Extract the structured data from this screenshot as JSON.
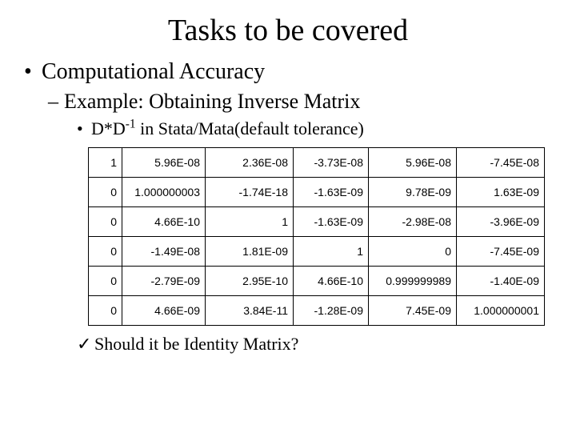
{
  "title": "Tasks to be covered",
  "bullet1": "Computational Accuracy",
  "bullet2": "Example: Obtaining Inverse Matrix",
  "bullet3_pre": "D*D",
  "bullet3_sup": "-1",
  "bullet3_post": " in Stata/Mata(default tolerance)",
  "checkline": "Should it be Identity Matrix?",
  "chart_data": {
    "type": "table",
    "title": "D*D^-1 in Stata/Mata (default tolerance)",
    "rows": [
      [
        "1",
        "5.96E-08",
        "2.36E-08",
        "-3.73E-08",
        "5.96E-08",
        "-7.45E-08"
      ],
      [
        "0",
        "1.000000003",
        "-1.74E-18",
        "-1.63E-09",
        "9.78E-09",
        "1.63E-09"
      ],
      [
        "0",
        "4.66E-10",
        "1",
        "-1.63E-09",
        "-2.98E-08",
        "-3.96E-09"
      ],
      [
        "0",
        "-1.49E-08",
        "1.81E-09",
        "1",
        "0",
        "-7.45E-09"
      ],
      [
        "0",
        "-2.79E-09",
        "2.95E-10",
        "4.66E-10",
        "0.999999989",
        "-1.40E-09"
      ],
      [
        "0",
        "4.66E-09",
        "3.84E-11",
        "-1.28E-09",
        "7.45E-09",
        "1.000000001"
      ]
    ]
  }
}
